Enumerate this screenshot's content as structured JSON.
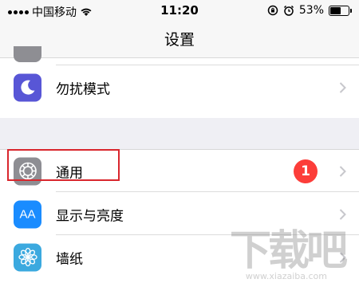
{
  "status_bar": {
    "carrier": "中国移动",
    "time": "11:20",
    "battery_percent": "53%",
    "battery_level": 0.53,
    "icons": [
      "signal-icon",
      "wifi-icon",
      "rotation-lock-icon",
      "alarm-icon",
      "battery-icon"
    ]
  },
  "nav": {
    "title": "设置"
  },
  "settings": {
    "dnd": {
      "label": "勿扰模式",
      "icon": "moon-icon",
      "icon_color": "#5856d6"
    },
    "general": {
      "label": "通用",
      "icon": "gear-icon",
      "icon_color": "#8e8e93",
      "badge": "1",
      "badge_color": "#fc3d39"
    },
    "display": {
      "label": "显示与亮度",
      "icon": "display-aa-icon",
      "icon_text": "AA",
      "icon_color": "#1a8cff"
    },
    "wallpaper": {
      "label": "墙纸",
      "icon": "flower-icon",
      "icon_color": "#3ba9df"
    }
  },
  "annotation": {
    "highlight_color": "#d9262d"
  },
  "watermark": {
    "text": "下载吧",
    "sub": "www.xiazaiba.com"
  }
}
